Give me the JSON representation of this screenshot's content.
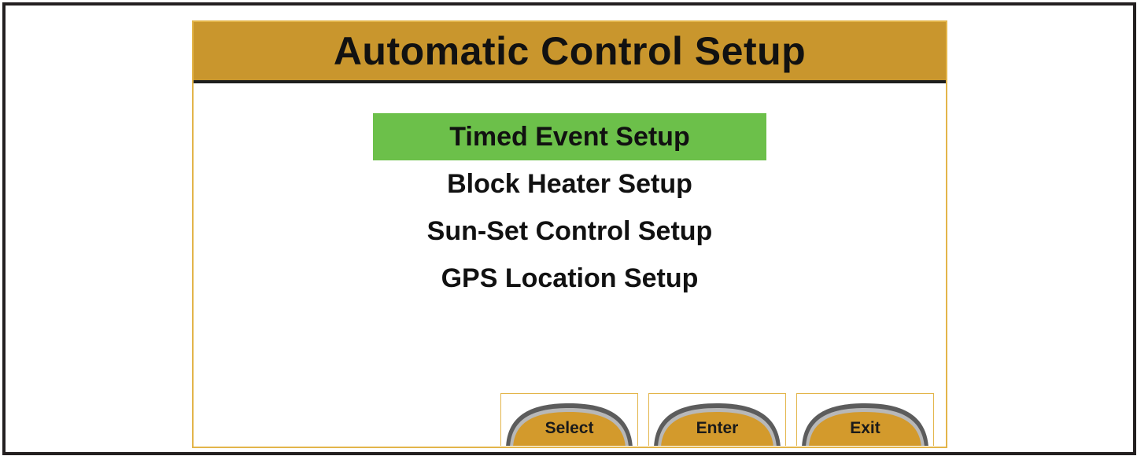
{
  "screen": {
    "title": "Automatic Control Setup"
  },
  "menu": {
    "items": [
      {
        "label": "Timed Event Setup",
        "selected": true
      },
      {
        "label": "Block Heater Setup",
        "selected": false
      },
      {
        "label": "Sun-Set Control Setup",
        "selected": false
      },
      {
        "label": "GPS Location Setup",
        "selected": false
      }
    ]
  },
  "softkeys": {
    "select_label": "Select",
    "enter_label": "Enter",
    "exit_label": "Exit"
  },
  "colors": {
    "header_bg": "#c9962d",
    "selection_bg": "#6cc04a",
    "button_fill": "#d39a2c",
    "frame_border": "#e3b54a"
  }
}
